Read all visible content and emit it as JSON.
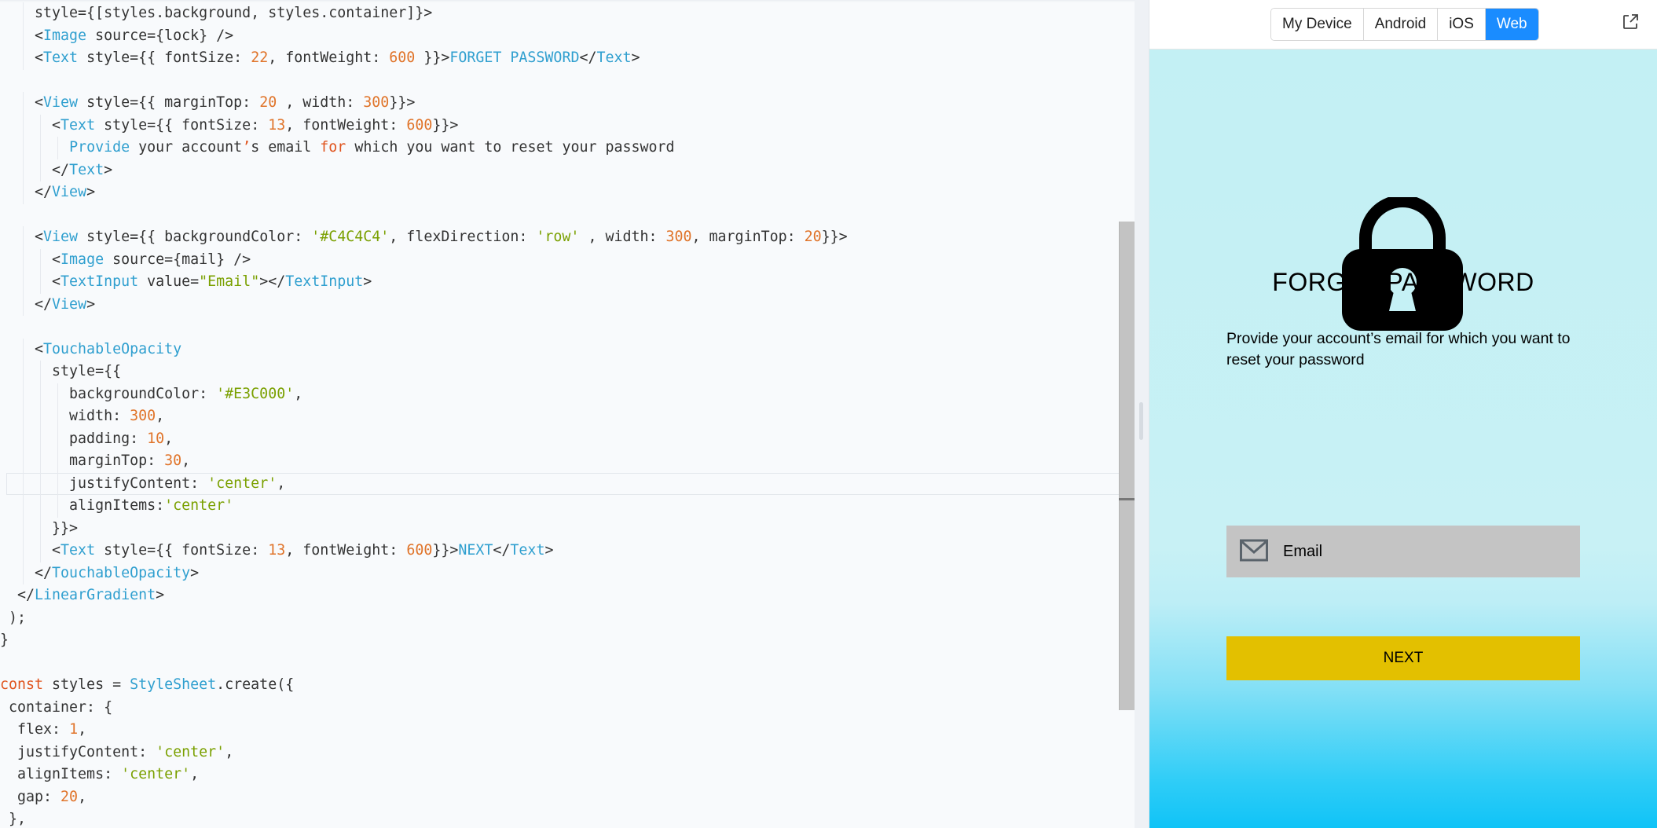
{
  "editor": {
    "code_lines": [
      [
        {
          "t": "    style={[styles.background, styles.container]}>",
          "c": "plain"
        }
      ],
      [
        {
          "t": "    <",
          "c": "plain"
        },
        {
          "t": "Image",
          "c": "tag"
        },
        {
          "t": " source={lock} />",
          "c": "plain"
        }
      ],
      [
        {
          "t": "    <",
          "c": "plain"
        },
        {
          "t": "Text",
          "c": "tag"
        },
        {
          "t": " style={{ fontSize: ",
          "c": "plain"
        },
        {
          "t": "22",
          "c": "num"
        },
        {
          "t": ", fontWeight: ",
          "c": "plain"
        },
        {
          "t": "600",
          "c": "num"
        },
        {
          "t": " }}>",
          "c": "plain"
        },
        {
          "t": "FORGET PASSWORD",
          "c": "tag"
        },
        {
          "t": "</",
          "c": "plain"
        },
        {
          "t": "Text",
          "c": "tag"
        },
        {
          "t": ">",
          "c": "plain"
        }
      ],
      [
        {
          "t": "",
          "c": "plain"
        }
      ],
      [
        {
          "t": "    <",
          "c": "plain"
        },
        {
          "t": "View",
          "c": "tag"
        },
        {
          "t": " style={{ marginTop: ",
          "c": "plain"
        },
        {
          "t": "20",
          "c": "num"
        },
        {
          "t": " , width: ",
          "c": "plain"
        },
        {
          "t": "300",
          "c": "num"
        },
        {
          "t": "}}>",
          "c": "plain"
        }
      ],
      [
        {
          "t": "      <",
          "c": "plain"
        },
        {
          "t": "Text",
          "c": "tag"
        },
        {
          "t": " style={{ fontSize: ",
          "c": "plain"
        },
        {
          "t": "13",
          "c": "num"
        },
        {
          "t": ", fontWeight: ",
          "c": "plain"
        },
        {
          "t": "600",
          "c": "num"
        },
        {
          "t": "}}>",
          "c": "plain"
        }
      ],
      [
        {
          "t": "        ",
          "c": "plain"
        },
        {
          "t": "Provide",
          "c": "tag"
        },
        {
          "t": " your account",
          "c": "plain"
        },
        {
          "t": "’",
          "c": "kw"
        },
        {
          "t": "s email ",
          "c": "plain"
        },
        {
          "t": "for",
          "c": "kw"
        },
        {
          "t": " which you want to reset your password",
          "c": "plain"
        }
      ],
      [
        {
          "t": "      </",
          "c": "plain"
        },
        {
          "t": "Text",
          "c": "tag"
        },
        {
          "t": ">",
          "c": "plain"
        }
      ],
      [
        {
          "t": "    </",
          "c": "plain"
        },
        {
          "t": "View",
          "c": "tag"
        },
        {
          "t": ">",
          "c": "plain"
        }
      ],
      [
        {
          "t": "",
          "c": "plain"
        }
      ],
      [
        {
          "t": "    <",
          "c": "plain"
        },
        {
          "t": "View",
          "c": "tag"
        },
        {
          "t": " style={{ backgroundColor: ",
          "c": "plain"
        },
        {
          "t": "'#C4C4C4'",
          "c": "str"
        },
        {
          "t": ", flexDirection: ",
          "c": "plain"
        },
        {
          "t": "'row'",
          "c": "str"
        },
        {
          "t": " , width: ",
          "c": "plain"
        },
        {
          "t": "300",
          "c": "num"
        },
        {
          "t": ", marginTop: ",
          "c": "plain"
        },
        {
          "t": "20",
          "c": "num"
        },
        {
          "t": "}}>",
          "c": "plain"
        }
      ],
      [
        {
          "t": "      <",
          "c": "plain"
        },
        {
          "t": "Image",
          "c": "tag"
        },
        {
          "t": " source={mail} />",
          "c": "plain"
        }
      ],
      [
        {
          "t": "      <",
          "c": "plain"
        },
        {
          "t": "TextInput",
          "c": "tag"
        },
        {
          "t": " value=",
          "c": "plain"
        },
        {
          "t": "\"Email\"",
          "c": "str"
        },
        {
          "t": "></",
          "c": "plain"
        },
        {
          "t": "TextInput",
          "c": "tag"
        },
        {
          "t": ">",
          "c": "plain"
        }
      ],
      [
        {
          "t": "    </",
          "c": "plain"
        },
        {
          "t": "View",
          "c": "tag"
        },
        {
          "t": ">",
          "c": "plain"
        }
      ],
      [
        {
          "t": "",
          "c": "plain"
        }
      ],
      [
        {
          "t": "    <",
          "c": "plain"
        },
        {
          "t": "TouchableOpacity",
          "c": "tag"
        }
      ],
      [
        {
          "t": "      style={{",
          "c": "plain"
        }
      ],
      [
        {
          "t": "        backgroundColor: ",
          "c": "plain"
        },
        {
          "t": "'#E3C000'",
          "c": "str"
        },
        {
          "t": ",",
          "c": "plain"
        }
      ],
      [
        {
          "t": "        width: ",
          "c": "plain"
        },
        {
          "t": "300",
          "c": "num"
        },
        {
          "t": ",",
          "c": "plain"
        }
      ],
      [
        {
          "t": "        padding: ",
          "c": "plain"
        },
        {
          "t": "10",
          "c": "num"
        },
        {
          "t": ",",
          "c": "plain"
        }
      ],
      [
        {
          "t": "        marginTop: ",
          "c": "plain"
        },
        {
          "t": "30",
          "c": "num"
        },
        {
          "t": ",",
          "c": "plain"
        }
      ],
      [
        {
          "t": "        justifyContent: ",
          "c": "plain"
        },
        {
          "t": "'center'",
          "c": "str"
        },
        {
          "t": ",",
          "c": "plain"
        }
      ],
      [
        {
          "t": "        alignItems:",
          "c": "plain"
        },
        {
          "t": "'center'",
          "c": "str"
        }
      ],
      [
        {
          "t": "      }}>",
          "c": "plain"
        }
      ],
      [
        {
          "t": "      <",
          "c": "plain"
        },
        {
          "t": "Text",
          "c": "tag"
        },
        {
          "t": " style={{ fontSize: ",
          "c": "plain"
        },
        {
          "t": "13",
          "c": "num"
        },
        {
          "t": ", fontWeight: ",
          "c": "plain"
        },
        {
          "t": "600",
          "c": "num"
        },
        {
          "t": "}}>",
          "c": "plain"
        },
        {
          "t": "NEXT",
          "c": "tag"
        },
        {
          "t": "</",
          "c": "plain"
        },
        {
          "t": "Text",
          "c": "tag"
        },
        {
          "t": ">",
          "c": "plain"
        }
      ],
      [
        {
          "t": "    </",
          "c": "plain"
        },
        {
          "t": "TouchableOpacity",
          "c": "tag"
        },
        {
          "t": ">",
          "c": "plain"
        }
      ],
      [
        {
          "t": "  </",
          "c": "plain"
        },
        {
          "t": "LinearGradient",
          "c": "tag"
        },
        {
          "t": ">",
          "c": "plain"
        }
      ],
      [
        {
          "t": " );",
          "c": "plain"
        }
      ],
      [
        {
          "t": "}",
          "c": "plain"
        }
      ],
      [
        {
          "t": "",
          "c": "plain"
        }
      ],
      [
        {
          "t": "const",
          "c": "kw"
        },
        {
          "t": " styles = ",
          "c": "plain"
        },
        {
          "t": "StyleSheet",
          "c": "tag"
        },
        {
          "t": ".create({",
          "c": "plain"
        }
      ],
      [
        {
          "t": " container: {",
          "c": "plain"
        }
      ],
      [
        {
          "t": "  flex: ",
          "c": "plain"
        },
        {
          "t": "1",
          "c": "num"
        },
        {
          "t": ",",
          "c": "plain"
        }
      ],
      [
        {
          "t": "  justifyContent: ",
          "c": "plain"
        },
        {
          "t": "'center'",
          "c": "str"
        },
        {
          "t": ",",
          "c": "plain"
        }
      ],
      [
        {
          "t": "  alignItems: ",
          "c": "plain"
        },
        {
          "t": "'center'",
          "c": "str"
        },
        {
          "t": ",",
          "c": "plain"
        }
      ],
      [
        {
          "t": "  gap: ",
          "c": "plain"
        },
        {
          "t": "20",
          "c": "num"
        },
        {
          "t": ",",
          "c": "plain"
        }
      ],
      [
        {
          "t": " },",
          "c": "plain"
        }
      ]
    ],
    "active_line_index": 21,
    "colors": {
      "tag": "#2f9fcf",
      "str": "#7aa000",
      "num": "#e0742a",
      "kw": "#e0541e",
      "plain": "#333333"
    }
  },
  "preview": {
    "platform_tabs": [
      {
        "label": "My Device",
        "active": false
      },
      {
        "label": "Android",
        "active": false
      },
      {
        "label": "iOS",
        "active": false
      },
      {
        "label": "Web",
        "active": true
      }
    ],
    "popout_icon": "external-link-icon",
    "app": {
      "lock_icon": "lock-icon",
      "title": "FORGET PASSWORD",
      "description": "Provide your account’s email for which you want to reset your password",
      "email_icon": "mail-icon",
      "email_value": "Email",
      "next_label": "NEXT",
      "colors": {
        "input_bg": "#C4C4C4",
        "button_bg": "#E3C000",
        "active_tab": "#1A8CFF"
      }
    }
  }
}
